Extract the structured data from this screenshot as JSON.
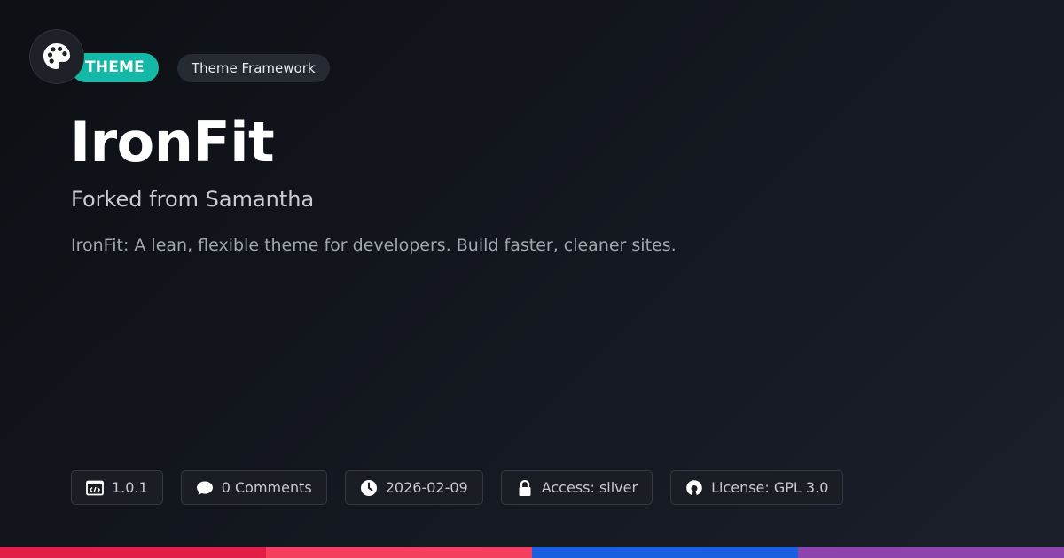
{
  "header": {
    "logo_icon": "palette-icon",
    "type_badge": "THEME",
    "category_badge": "Theme Framework"
  },
  "main": {
    "title": "IronFit",
    "subtitle": "Forked from Samantha",
    "description": "IronFit: A lean, flexible theme for developers. Build faster, cleaner sites."
  },
  "meta": {
    "version": {
      "icon": "code-window-icon",
      "label": "1.0.1"
    },
    "comments": {
      "icon": "speech-bubble-icon",
      "label": "0 Comments"
    },
    "date": {
      "icon": "clock-icon",
      "label": "2026-02-09"
    },
    "access": {
      "icon": "lock-icon",
      "label": "Access: silver"
    },
    "license": {
      "icon": "open-source-icon",
      "label": "License: GPL 3.0"
    }
  },
  "colors": {
    "background": "#12151c",
    "theme_badge": "#14b8a6",
    "bar_segment_1": "#e11d48",
    "bar_segment_2": "#f43f5e",
    "bar_segment_3": "#1a5fe0",
    "bar_segment_4": "#8e44ad"
  }
}
